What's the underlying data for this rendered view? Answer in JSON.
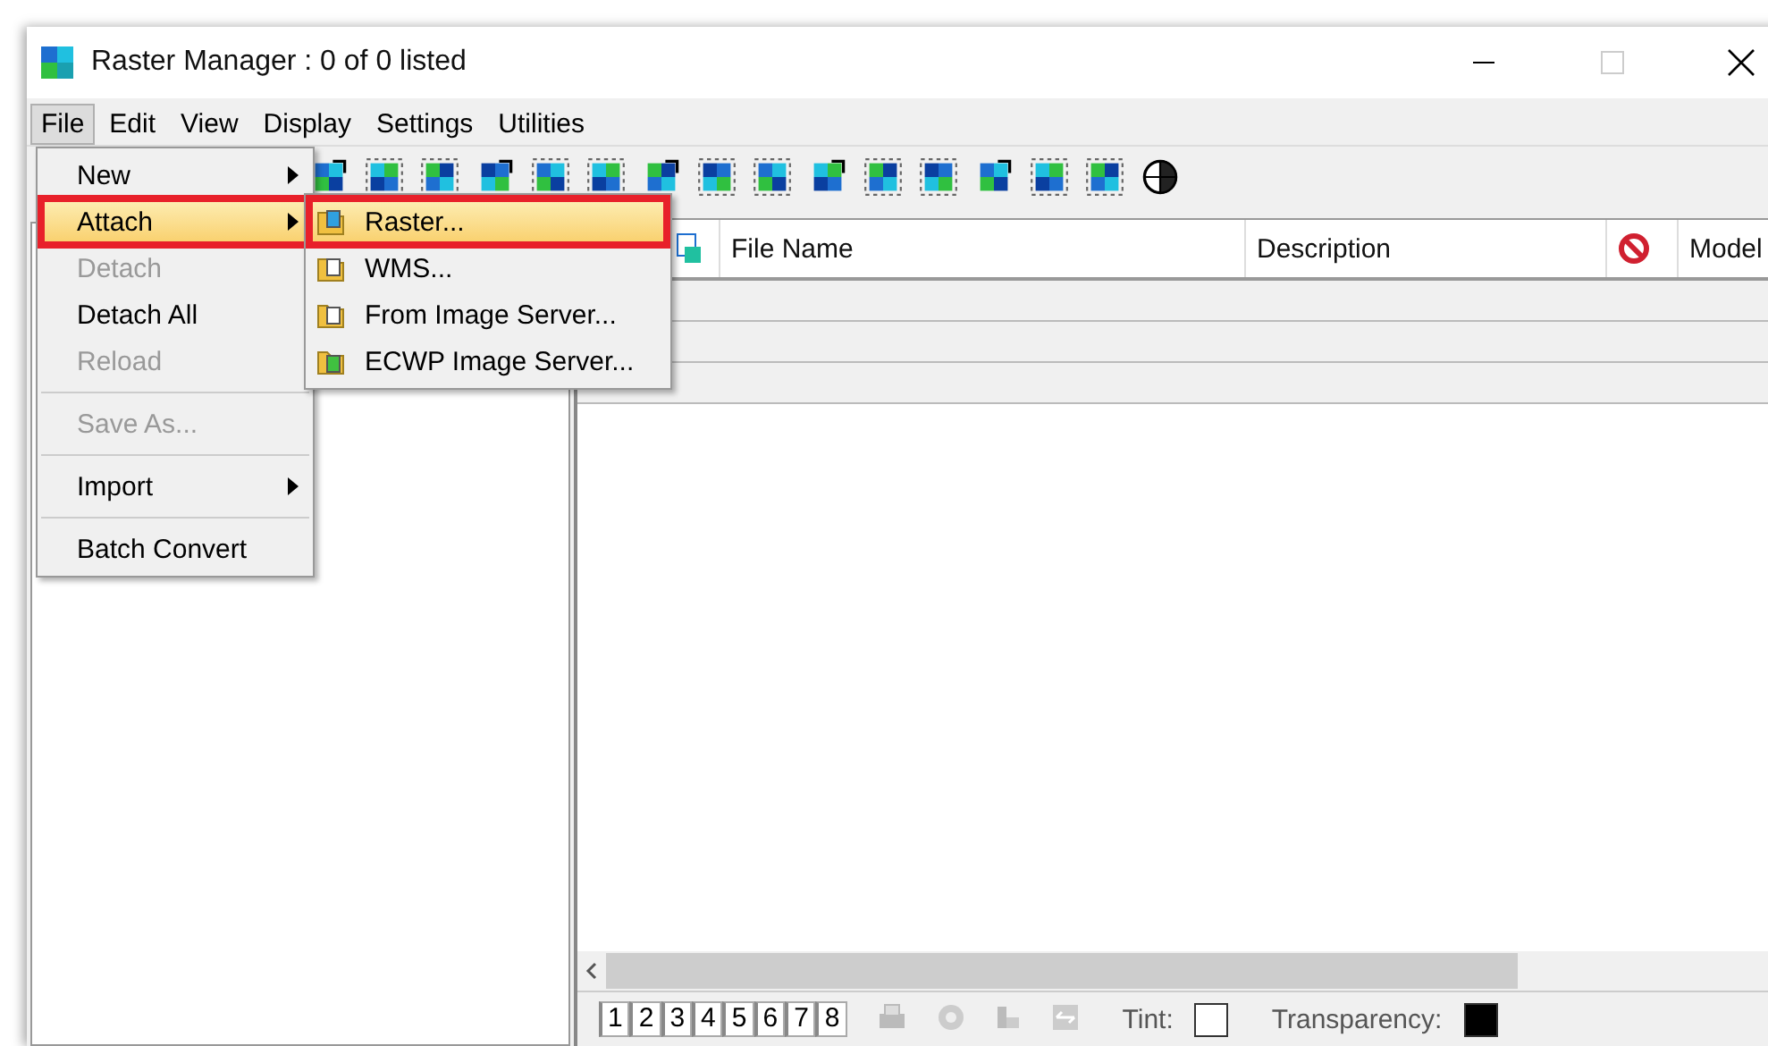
{
  "window": {
    "title": "Raster Manager : 0 of 0 listed"
  },
  "menu_bar": [
    {
      "label": "File",
      "selected": true
    },
    {
      "label": "Edit",
      "selected": false
    },
    {
      "label": "View",
      "selected": false
    },
    {
      "label": "Display",
      "selected": false
    },
    {
      "label": "Settings",
      "selected": false
    },
    {
      "label": "Utilities",
      "selected": false
    }
  ],
  "file_menu": [
    {
      "kind": "item",
      "label": "New",
      "submenu": true,
      "disabled": false,
      "selected": false,
      "outlined": false
    },
    {
      "kind": "item",
      "label": "Attach",
      "submenu": true,
      "disabled": false,
      "selected": true,
      "outlined": true
    },
    {
      "kind": "item",
      "label": "Detach",
      "submenu": false,
      "disabled": true,
      "selected": false,
      "outlined": false
    },
    {
      "kind": "item",
      "label": "Detach All",
      "submenu": false,
      "disabled": false,
      "selected": false,
      "outlined": false
    },
    {
      "kind": "item",
      "label": "Reload",
      "submenu": false,
      "disabled": true,
      "selected": false,
      "outlined": false
    },
    {
      "kind": "separator"
    },
    {
      "kind": "item",
      "label": "Save As...",
      "submenu": false,
      "disabled": true,
      "selected": false,
      "outlined": false
    },
    {
      "kind": "separator"
    },
    {
      "kind": "item",
      "label": "Import",
      "submenu": true,
      "disabled": false,
      "selected": false,
      "outlined": false
    },
    {
      "kind": "separator"
    },
    {
      "kind": "item",
      "label": "Batch Convert",
      "submenu": false,
      "disabled": false,
      "selected": false,
      "outlined": false
    }
  ],
  "attach_submenu": [
    {
      "label": "Raster...",
      "selected": true,
      "outlined": true
    },
    {
      "label": "WMS...",
      "selected": false,
      "outlined": false
    },
    {
      "label": "From Image Server...",
      "selected": false,
      "outlined": false
    },
    {
      "label": "ECWP Image Server...",
      "selected": false,
      "outlined": false
    }
  ],
  "table": {
    "columns": [
      {
        "kind": "icon"
      },
      {
        "kind": "text",
        "label": "File Name"
      },
      {
        "kind": "text",
        "label": "Description"
      },
      {
        "kind": "icon"
      },
      {
        "kind": "text",
        "label": "Model"
      }
    ]
  },
  "view_tabs": [
    "1",
    "2",
    "3",
    "4",
    "5",
    "6",
    "7",
    "8"
  ],
  "tint": {
    "label": "Tint:",
    "color": "#ffffff"
  },
  "transparency": {
    "label": "Transparency:",
    "color": "#000000"
  }
}
